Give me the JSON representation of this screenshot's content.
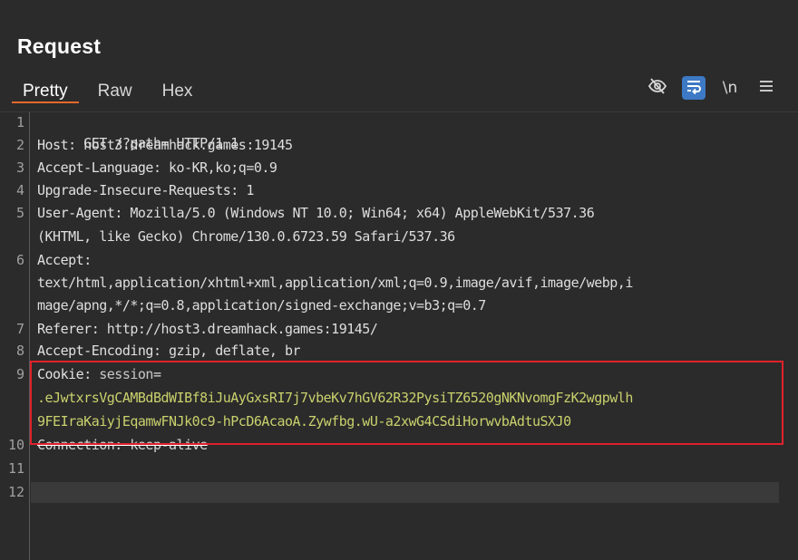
{
  "panel": {
    "title": "Request"
  },
  "tabs": [
    {
      "label": "Pretty",
      "active": true
    },
    {
      "label": "Raw",
      "active": false
    },
    {
      "label": "Hex",
      "active": false
    }
  ],
  "toolbar": {
    "newline_label": "\\n",
    "icons": [
      "eye-off-icon",
      "wrap-text-icon",
      "newline-icon",
      "menu-icon"
    ],
    "active_color": "#3d79c4"
  },
  "editor": {
    "line_numbers": [
      "1",
      "2",
      "3",
      "4",
      "5",
      "",
      "6",
      "",
      "",
      "7",
      "8",
      "9",
      "",
      "",
      "10",
      "11",
      "12"
    ],
    "lines": {
      "l1": "GET /?path= HTTP/1.1",
      "l2_name": "Host",
      "l2_val": ": host3.dreamhack.games:19145",
      "l3_name": "Accept-Language",
      "l3_val": ": ko-KR,ko;q=0.9",
      "l4_name": "Upgrade-Insecure-Requests",
      "l4_val": ": 1",
      "l5_name": "User-Agent",
      "l5_val": ": Mozilla/5.0 (Windows NT 10.0; Win64; x64) AppleWebKit/537.36",
      "l5_cont": "(KHTML, like Gecko) Chrome/130.0.6723.59 Safari/537.36",
      "l6_name": "Accept",
      "l6_val": ":",
      "l6_cont1": "text/html,application/xhtml+xml,application/xml;q=0.9,image/avif,image/webp,i",
      "l6_cont2": "mage/apng,*/*;q=0.8,application/signed-exchange;v=b3;q=0.7",
      "l7_name": "Referer",
      "l7_val": ": http://host3.dreamhack.games:19145/",
      "l8_name": "Accept-Encoding",
      "l8_val": ": gzip, deflate, br",
      "l9_name": "Cookie",
      "l9_sep": ": ",
      "l9_key": "session",
      "l9_eq": "=",
      "l9_cont1": ".eJwtxrsVgCAMBdBdWIBf8iJuAyGxsRI7j7vbeKv7hGV62R32PysiTZ6520gNKNvomgFzK2wgpwlh",
      "l9_cont2": "9FEIraKaiyjEqamwFNJk0c9-hPcD6AcaoA.Zywfbg.wU-a2xwG4CSdiHorwvbAdtuSXJ0",
      "l10": "Connection: keep-alive",
      "l11": "",
      "l12": ""
    },
    "highlight_color": "#e0212b",
    "cookie_value_color": "#c9d16c"
  }
}
